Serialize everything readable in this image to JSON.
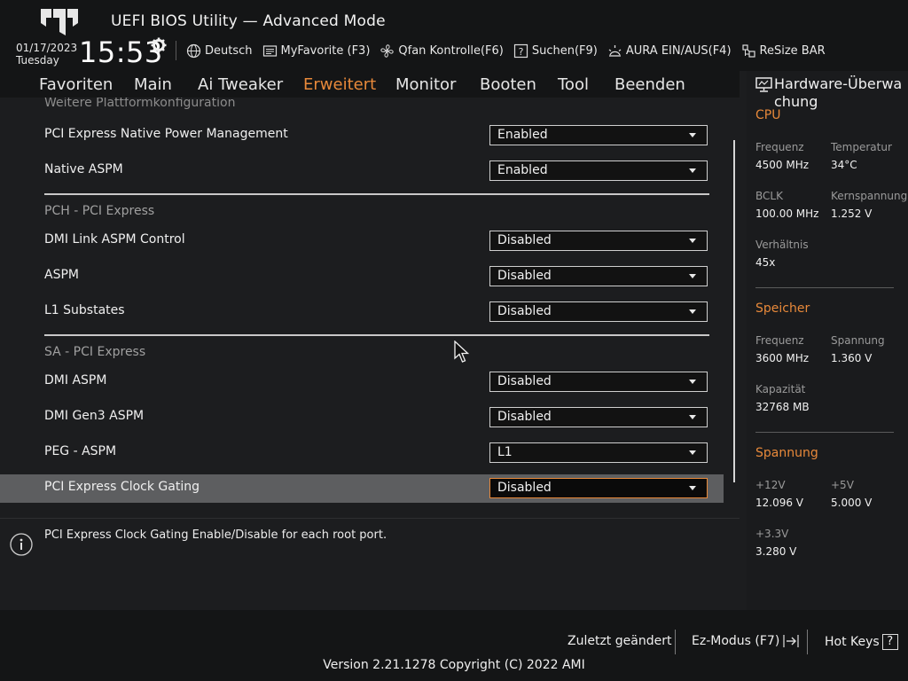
{
  "header": {
    "title": "UEFI BIOS Utility — Advanced Mode",
    "date": "01/17/2023",
    "weekday": "Tuesday",
    "time": "15:53",
    "toolbar": [
      {
        "label": "Deutsch",
        "icon": "globe-icon"
      },
      {
        "label": "MyFavorite (F3)",
        "icon": "favorite-icon"
      },
      {
        "label": "Qfan Kontrolle(F6)",
        "icon": "fan-icon"
      },
      {
        "label": "Suchen(F9)",
        "icon": "search-help-icon"
      },
      {
        "label": "AURA EIN/AUS(F4)",
        "icon": "aura-icon"
      },
      {
        "label": "ReSize BAR",
        "icon": "resize-bar-icon"
      }
    ]
  },
  "nav": {
    "tabs": [
      "Favoriten",
      "Main",
      "Ai Tweaker",
      "Erweitert",
      "Monitor",
      "Booten",
      "Tool",
      "Beenden"
    ],
    "active": "Erweitert"
  },
  "settings": {
    "partial_header": "Weitere Plattformkonfiguration",
    "rows_top": [
      {
        "label": "PCI Express Native Power Management",
        "value": "Enabled"
      },
      {
        "label": "Native ASPM",
        "value": "Enabled"
      }
    ],
    "pch_section": "PCH - PCI Express",
    "rows_pch": [
      {
        "label": "DMI Link ASPM Control",
        "value": "Disabled"
      },
      {
        "label": "ASPM",
        "value": "Disabled"
      },
      {
        "label": "L1 Substates",
        "value": "Disabled"
      }
    ],
    "sa_section": "SA - PCI Express",
    "rows_sa": [
      {
        "label": "DMI ASPM",
        "value": "Disabled"
      },
      {
        "label": "DMI Gen3 ASPM",
        "value": "Disabled"
      },
      {
        "label": "PEG - ASPM",
        "value": "L1"
      },
      {
        "label": "PCI Express Clock Gating",
        "value": "Disabled"
      }
    ]
  },
  "help": {
    "text": "PCI Express Clock Gating Enable/Disable for each root port."
  },
  "hardware": {
    "title": "Hardware-Überwachung",
    "cpu": {
      "heading": "CPU",
      "freq_label": "Frequenz",
      "freq": "4500 MHz",
      "temp_label": "Temperatur",
      "temp": "34°C",
      "bclk_label": "BCLK",
      "bclk": "100.00 MHz",
      "vcore_label": "Kernspannung",
      "vcore": "1.252 V",
      "ratio_label": "Verhältnis",
      "ratio": "45x"
    },
    "memory": {
      "heading": "Speicher",
      "freq_label": "Frequenz",
      "freq": "3600 MHz",
      "volt_label": "Spannung",
      "volt": "1.360 V",
      "cap_label": "Kapazität",
      "cap": "32768 MB"
    },
    "voltage": {
      "heading": "Spannung",
      "v12_label": "+12V",
      "v12": "12.096 V",
      "v5_label": "+5V",
      "v5": "5.000 V",
      "v33_label": "+3.3V",
      "v33": "3.280 V"
    }
  },
  "footer": {
    "last_changed": "Zuletzt geändert",
    "ez_mode": "Ez-Modus (F7)",
    "hot_keys": "Hot Keys",
    "hot_keys_key": "?",
    "version": "Version 2.21.1278 Copyright (C) 2022 AMI"
  }
}
